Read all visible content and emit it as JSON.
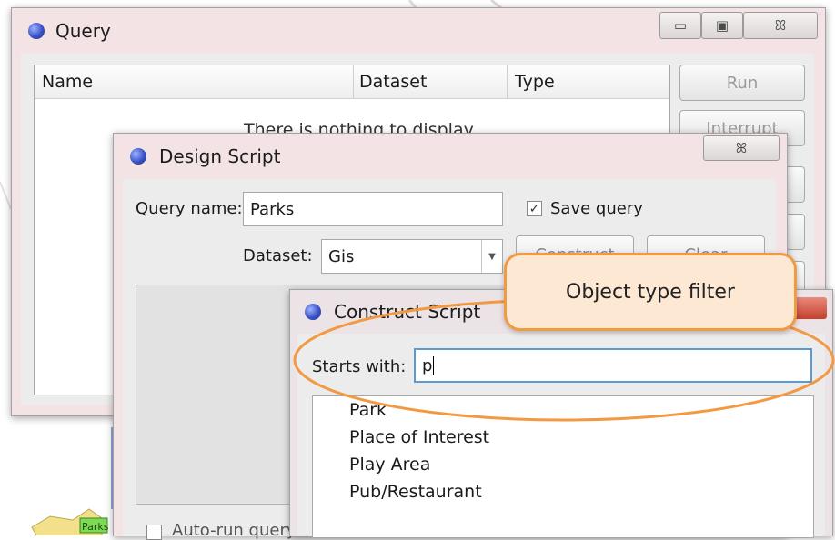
{
  "query_window": {
    "title": "Query",
    "caption_buttons": {
      "minimize": "▭",
      "restore": "▣",
      "close": "ꕤ"
    },
    "table": {
      "columns": [
        "Name",
        "Dataset",
        "Type"
      ],
      "empty_message": "There is nothing to display"
    },
    "buttons": {
      "run": "Run",
      "interrupt": "Interrupt"
    }
  },
  "design_window": {
    "title": "Design Script",
    "close_glyph": "ꕤ",
    "query_name_label": "Query name:",
    "query_name_value": "Parks",
    "save_query_label": "Save query",
    "save_query_checked": true,
    "dataset_label": "Dataset:",
    "dataset_value": "Gis",
    "buttons": {
      "construct": "Construct",
      "clear": "Clear"
    },
    "auto_run_label": "Auto-run query"
  },
  "construct_window": {
    "title": "Construct Script",
    "starts_with_label": "Starts with:",
    "starts_with_value": "p",
    "items": [
      "Park",
      "Place of Interest",
      "Play Area",
      "Pub/Restaurant"
    ]
  },
  "callout": {
    "text": "Object type filter",
    "color": "#f29a43",
    "fill": "#fde8d4"
  },
  "map_label": "Parks"
}
